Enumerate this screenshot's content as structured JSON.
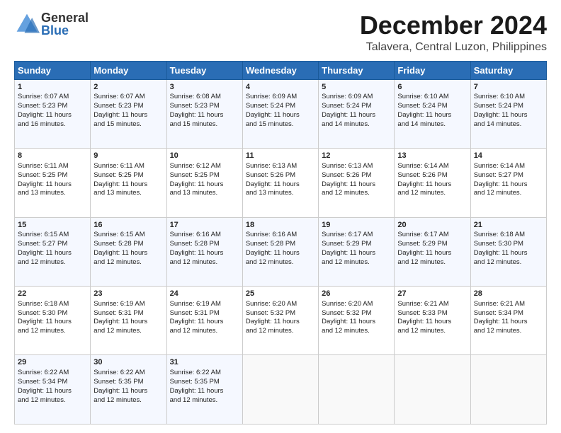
{
  "header": {
    "logo_general": "General",
    "logo_blue": "Blue",
    "main_title": "December 2024",
    "subtitle": "Talavera, Central Luzon, Philippines"
  },
  "days_of_week": [
    "Sunday",
    "Monday",
    "Tuesday",
    "Wednesday",
    "Thursday",
    "Friday",
    "Saturday"
  ],
  "weeks": [
    [
      {
        "day": "1",
        "lines": [
          "Sunrise: 6:07 AM",
          "Sunset: 5:23 PM",
          "Daylight: 11 hours",
          "and 16 minutes."
        ]
      },
      {
        "day": "2",
        "lines": [
          "Sunrise: 6:07 AM",
          "Sunset: 5:23 PM",
          "Daylight: 11 hours",
          "and 15 minutes."
        ]
      },
      {
        "day": "3",
        "lines": [
          "Sunrise: 6:08 AM",
          "Sunset: 5:23 PM",
          "Daylight: 11 hours",
          "and 15 minutes."
        ]
      },
      {
        "day": "4",
        "lines": [
          "Sunrise: 6:09 AM",
          "Sunset: 5:24 PM",
          "Daylight: 11 hours",
          "and 15 minutes."
        ]
      },
      {
        "day": "5",
        "lines": [
          "Sunrise: 6:09 AM",
          "Sunset: 5:24 PM",
          "Daylight: 11 hours",
          "and 14 minutes."
        ]
      },
      {
        "day": "6",
        "lines": [
          "Sunrise: 6:10 AM",
          "Sunset: 5:24 PM",
          "Daylight: 11 hours",
          "and 14 minutes."
        ]
      },
      {
        "day": "7",
        "lines": [
          "Sunrise: 6:10 AM",
          "Sunset: 5:24 PM",
          "Daylight: 11 hours",
          "and 14 minutes."
        ]
      }
    ],
    [
      {
        "day": "8",
        "lines": [
          "Sunrise: 6:11 AM",
          "Sunset: 5:25 PM",
          "Daylight: 11 hours",
          "and 13 minutes."
        ]
      },
      {
        "day": "9",
        "lines": [
          "Sunrise: 6:11 AM",
          "Sunset: 5:25 PM",
          "Daylight: 11 hours",
          "and 13 minutes."
        ]
      },
      {
        "day": "10",
        "lines": [
          "Sunrise: 6:12 AM",
          "Sunset: 5:25 PM",
          "Daylight: 11 hours",
          "and 13 minutes."
        ]
      },
      {
        "day": "11",
        "lines": [
          "Sunrise: 6:13 AM",
          "Sunset: 5:26 PM",
          "Daylight: 11 hours",
          "and 13 minutes."
        ]
      },
      {
        "day": "12",
        "lines": [
          "Sunrise: 6:13 AM",
          "Sunset: 5:26 PM",
          "Daylight: 11 hours",
          "and 12 minutes."
        ]
      },
      {
        "day": "13",
        "lines": [
          "Sunrise: 6:14 AM",
          "Sunset: 5:26 PM",
          "Daylight: 11 hours",
          "and 12 minutes."
        ]
      },
      {
        "day": "14",
        "lines": [
          "Sunrise: 6:14 AM",
          "Sunset: 5:27 PM",
          "Daylight: 11 hours",
          "and 12 minutes."
        ]
      }
    ],
    [
      {
        "day": "15",
        "lines": [
          "Sunrise: 6:15 AM",
          "Sunset: 5:27 PM",
          "Daylight: 11 hours",
          "and 12 minutes."
        ]
      },
      {
        "day": "16",
        "lines": [
          "Sunrise: 6:15 AM",
          "Sunset: 5:28 PM",
          "Daylight: 11 hours",
          "and 12 minutes."
        ]
      },
      {
        "day": "17",
        "lines": [
          "Sunrise: 6:16 AM",
          "Sunset: 5:28 PM",
          "Daylight: 11 hours",
          "and 12 minutes."
        ]
      },
      {
        "day": "18",
        "lines": [
          "Sunrise: 6:16 AM",
          "Sunset: 5:28 PM",
          "Daylight: 11 hours",
          "and 12 minutes."
        ]
      },
      {
        "day": "19",
        "lines": [
          "Sunrise: 6:17 AM",
          "Sunset: 5:29 PM",
          "Daylight: 11 hours",
          "and 12 minutes."
        ]
      },
      {
        "day": "20",
        "lines": [
          "Sunrise: 6:17 AM",
          "Sunset: 5:29 PM",
          "Daylight: 11 hours",
          "and 12 minutes."
        ]
      },
      {
        "day": "21",
        "lines": [
          "Sunrise: 6:18 AM",
          "Sunset: 5:30 PM",
          "Daylight: 11 hours",
          "and 12 minutes."
        ]
      }
    ],
    [
      {
        "day": "22",
        "lines": [
          "Sunrise: 6:18 AM",
          "Sunset: 5:30 PM",
          "Daylight: 11 hours",
          "and 12 minutes."
        ]
      },
      {
        "day": "23",
        "lines": [
          "Sunrise: 6:19 AM",
          "Sunset: 5:31 PM",
          "Daylight: 11 hours",
          "and 12 minutes."
        ]
      },
      {
        "day": "24",
        "lines": [
          "Sunrise: 6:19 AM",
          "Sunset: 5:31 PM",
          "Daylight: 11 hours",
          "and 12 minutes."
        ]
      },
      {
        "day": "25",
        "lines": [
          "Sunrise: 6:20 AM",
          "Sunset: 5:32 PM",
          "Daylight: 11 hours",
          "and 12 minutes."
        ]
      },
      {
        "day": "26",
        "lines": [
          "Sunrise: 6:20 AM",
          "Sunset: 5:32 PM",
          "Daylight: 11 hours",
          "and 12 minutes."
        ]
      },
      {
        "day": "27",
        "lines": [
          "Sunrise: 6:21 AM",
          "Sunset: 5:33 PM",
          "Daylight: 11 hours",
          "and 12 minutes."
        ]
      },
      {
        "day": "28",
        "lines": [
          "Sunrise: 6:21 AM",
          "Sunset: 5:34 PM",
          "Daylight: 11 hours",
          "and 12 minutes."
        ]
      }
    ],
    [
      {
        "day": "29",
        "lines": [
          "Sunrise: 6:22 AM",
          "Sunset: 5:34 PM",
          "Daylight: 11 hours",
          "and 12 minutes."
        ]
      },
      {
        "day": "30",
        "lines": [
          "Sunrise: 6:22 AM",
          "Sunset: 5:35 PM",
          "Daylight: 11 hours",
          "and 12 minutes."
        ]
      },
      {
        "day": "31",
        "lines": [
          "Sunrise: 6:22 AM",
          "Sunset: 5:35 PM",
          "Daylight: 11 hours",
          "and 12 minutes."
        ]
      },
      null,
      null,
      null,
      null
    ]
  ]
}
